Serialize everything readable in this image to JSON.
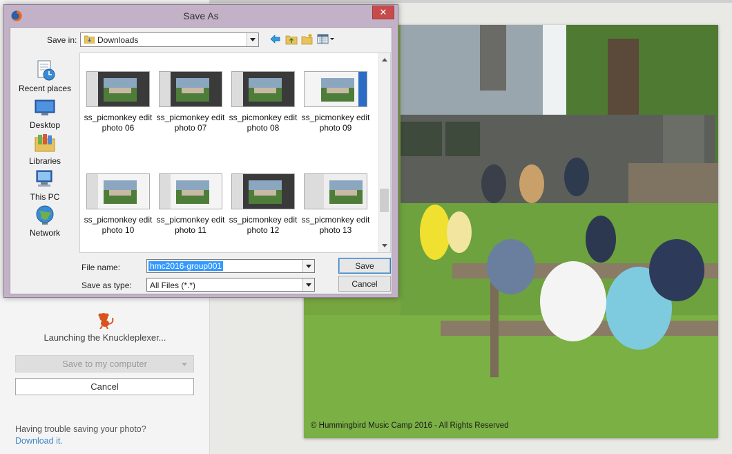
{
  "dialog": {
    "title": "Save As",
    "close_glyph": "✕",
    "save_in_label": "Save in:",
    "save_in_value": "Downloads",
    "places": [
      {
        "label": "Recent places",
        "icon": "recent-places-icon"
      },
      {
        "label": "Desktop",
        "icon": "desktop-icon"
      },
      {
        "label": "Libraries",
        "icon": "libraries-icon"
      },
      {
        "label": "This PC",
        "icon": "this-pc-icon"
      },
      {
        "label": "Network",
        "icon": "network-icon"
      }
    ],
    "files": [
      {
        "line1": "ss_picmonkey edit",
        "line2": "photo 06"
      },
      {
        "line1": "ss_picmonkey edit",
        "line2": "photo 07"
      },
      {
        "line1": "ss_picmonkey edit",
        "line2": "photo 08"
      },
      {
        "line1": "ss_picmonkey edit",
        "line2": "photo 09"
      },
      {
        "line1": "ss_picmonkey edit",
        "line2": "photo 10"
      },
      {
        "line1": "ss_picmonkey edit",
        "line2": "photo 11"
      },
      {
        "line1": "ss_picmonkey edit",
        "line2": "photo 12"
      },
      {
        "line1": "ss_picmonkey edit",
        "line2": "photo 13"
      }
    ],
    "file_name_label": "File name:",
    "file_name_value": "hmc2016-group001",
    "save_as_type_label": "Save as type:",
    "save_as_type_value": "All Files (*.*)",
    "save_button": "Save",
    "cancel_button": "Cancel"
  },
  "app": {
    "launch_text": "Launching the Knuckleplexer...",
    "save_to_computer": "Save to my computer",
    "cancel": "Cancel",
    "trouble_text": "Having trouble saving your photo?",
    "download_link": "Download it."
  },
  "photo": {
    "watermark": "© Hummingbird Music Camp 2016 - All Rights Reserved"
  },
  "colors": {
    "dialog_frame": "#c3b1c7",
    "close_button": "#c74b4b",
    "selection": "#3399ff",
    "link": "#3f86c8"
  }
}
